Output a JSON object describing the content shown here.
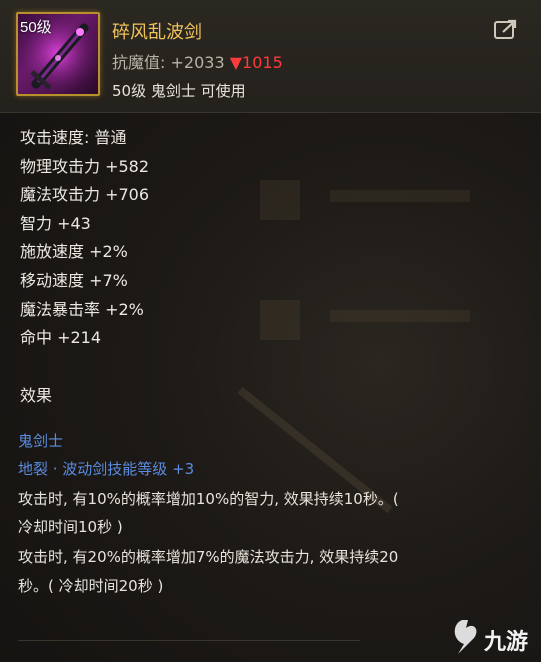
{
  "item": {
    "level_badge": "50级",
    "name": "碎风乱波剑",
    "magic_resist_label": "抗魔值:",
    "magic_resist_value": "+2033",
    "magic_resist_change": "▼1015",
    "requirement": "50级 鬼剑士 可使用",
    "icon": "purple-sword-icon"
  },
  "stats": [
    "攻击速度: 普通",
    "物理攻击力 +582",
    "魔法攻击力 +706",
    "智力 +43",
    "施放速度 +2%",
    "移动速度 +7%",
    "魔法暴击率 +2%",
    "命中 +214"
  ],
  "effects": {
    "title": "效果",
    "class_name": "鬼剑士",
    "skill_bonus": "地裂 · 波动剑技能等级 +3",
    "lines": [
      "攻击时, 有10%的概率增加10%的智力, 效果持续10秒。(",
      "冷却时间10秒 )",
      "攻击时, 有20%的概率增加7%的魔法攻击力, 效果持续20",
      "秒。( 冷却时间20秒 )"
    ]
  },
  "watermark": {
    "text": "九游",
    "icon": "jiuyou-logo-icon"
  },
  "colors": {
    "name": "#f0c25a",
    "blue_text": "#5b8ce0",
    "down_red": "#ff3a3a",
    "frame_gold": "#b8902c"
  }
}
